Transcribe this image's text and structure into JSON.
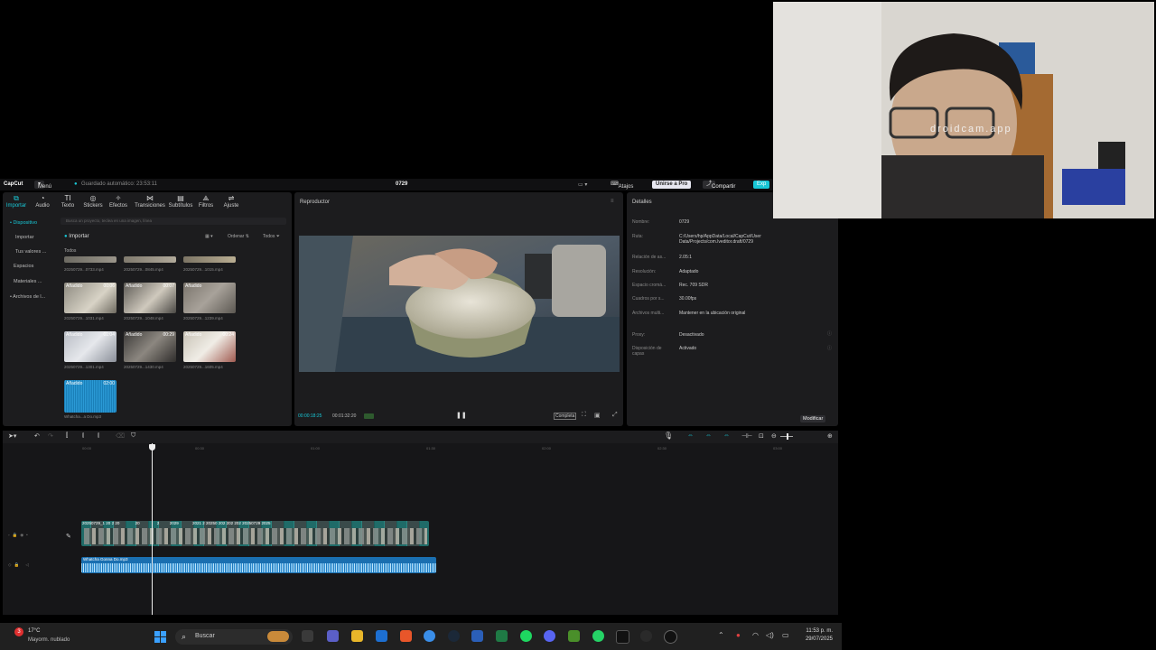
{
  "titlebar": {
    "app_name": "CapCut",
    "menu_label": "Menú",
    "autosave": "Guardado automático: 23:53:11",
    "project_name": "0729",
    "shortcuts_label": "Atajos",
    "pro_label": "Unirse a Pro",
    "share_label": "Compartir",
    "export_label": "Exp"
  },
  "toolbar": {
    "items": [
      {
        "label": "Importar",
        "icon": "import-icon"
      },
      {
        "label": "Audio",
        "icon": "audio-icon"
      },
      {
        "label": "Texto",
        "icon": "text-icon"
      },
      {
        "label": "Stickers",
        "icon": "sticker-icon"
      },
      {
        "label": "Efectos",
        "icon": "effects-icon"
      },
      {
        "label": "Transiciones",
        "icon": "transitions-icon"
      },
      {
        "label": "Subtítulos",
        "icon": "subtitles-icon"
      },
      {
        "label": "Filtros",
        "icon": "filters-icon"
      },
      {
        "label": "Ajuste",
        "icon": "adjust-icon"
      }
    ]
  },
  "sidebar": {
    "items": [
      "• Dispositivo",
      "Importar",
      "Tus valores ...",
      "Espacios",
      "Materiales ...",
      "• Archivos de l..."
    ]
  },
  "media": {
    "search_placeholder": "Busca un proyecto, teclea en una imagen, línea",
    "import_label": "Importar",
    "sort_label": "Ordenar",
    "filter_label": "Todos",
    "all_label": "Todos",
    "added_label": "Añadido",
    "clips": [
      {
        "name": "20250729...0733.mp4",
        "duration": ""
      },
      {
        "name": "20250729...0845.mp4",
        "duration": ""
      },
      {
        "name": "20250729...1015.mp4",
        "duration": ""
      },
      {
        "name": "20250729...1031.mp4",
        "duration": "00:06"
      },
      {
        "name": "20250729...1048.mp4",
        "duration": "00:07"
      },
      {
        "name": "20250729...1239.mp4",
        "duration": ""
      },
      {
        "name": "20250729...1301.mp4",
        "duration": "01:04"
      },
      {
        "name": "20250729...1430.mp4",
        "duration": "00:29"
      },
      {
        "name": "20250729...1605.mp4",
        "duration": "00:24"
      },
      {
        "name": "Whatcha...a Do.mp3",
        "duration": "02:00"
      }
    ]
  },
  "player": {
    "title": "Reproductor",
    "current_time": "00:00:18:25",
    "total_time": "00:01:32:20",
    "ratio_label": "Completa"
  },
  "details": {
    "title": "Detalles",
    "rows": [
      {
        "label": "Nombre:",
        "value": "0729"
      },
      {
        "label": "Ruta:",
        "value": "C:/Users/hp/AppData/Local/CapCut/User Data/Projects/com.lveditor.draft/0729"
      },
      {
        "label": "Relación de as...",
        "value": "2.05:1"
      },
      {
        "label": "Resolución:",
        "value": "Adaptado"
      },
      {
        "label": "Espacio cromá...",
        "value": "Rec. 709 SDR"
      },
      {
        "label": "Cuadros por s...",
        "value": "30.00fps"
      },
      {
        "label": "Archivos multi...",
        "value": "Mantener en la ubicación original"
      },
      {
        "label": "Proxy:",
        "value": "Desactivado"
      },
      {
        "label": "Disposición de capas",
        "value": "Activado"
      }
    ],
    "modify_label": "Modificar"
  },
  "timeline": {
    "ticks": [
      "00:00",
      "00:30",
      "01:00",
      "01:30",
      "02:00",
      "02:30",
      "03:00"
    ],
    "audio_clip": "Whatcha Gonna Do.mp3",
    "video_clip_labels": [
      "20250729_1",
      "20",
      "2",
      "20",
      "20",
      "2",
      "2029",
      "2021",
      "2",
      "20250",
      "202",
      "202",
      "202",
      "20250729",
      "2025"
    ]
  },
  "webcam": {
    "watermark": "droidcam.app"
  },
  "taskbar": {
    "weather_temp": "17°C",
    "weather_desc": "Mayorm. nublado",
    "search_label": "Buscar",
    "time": "11:53 p. m.",
    "date": "29/07/2025",
    "badge": "3"
  }
}
